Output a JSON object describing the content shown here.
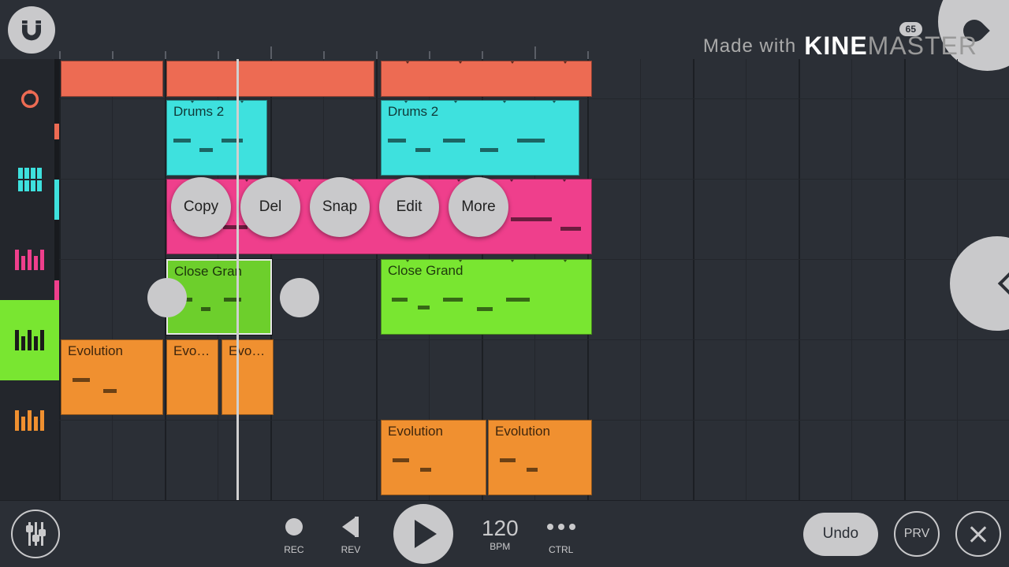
{
  "logo_badge": "65",
  "watermark": {
    "made": "Made with",
    "kine": "KINE",
    "master": "MASTER"
  },
  "tracks": [
    {
      "color": "#ed6b53",
      "level": 20
    },
    {
      "color": "#3ee1de",
      "level": 50
    },
    {
      "color": "#ef3f8c",
      "level": 25
    },
    {
      "color": "#79e631",
      "level": 0,
      "selected": true
    },
    {
      "color": "#f09030",
      "level": 0
    }
  ],
  "clips": {
    "drums2_a": "Drums 2",
    "drums2_b": "Drums 2",
    "closegrand_a": "Close Gran",
    "closegrand_b": "Close Grand",
    "evolution_a": "Evolution",
    "evolution_b": "Evolut...",
    "evolution_c": "Evolut...",
    "evolution_d": "Evolution",
    "evolution_e": "Evolution"
  },
  "context_menu": {
    "copy": "Copy",
    "del": "Del",
    "snap": "Snap",
    "edit": "Edit",
    "more": "More"
  },
  "transport": {
    "rec": "REC",
    "rev": "REV",
    "bpm_value": "120",
    "bpm_label": "BPM",
    "ctrl": "CTRL",
    "undo": "Undo",
    "prv": "PRV"
  }
}
